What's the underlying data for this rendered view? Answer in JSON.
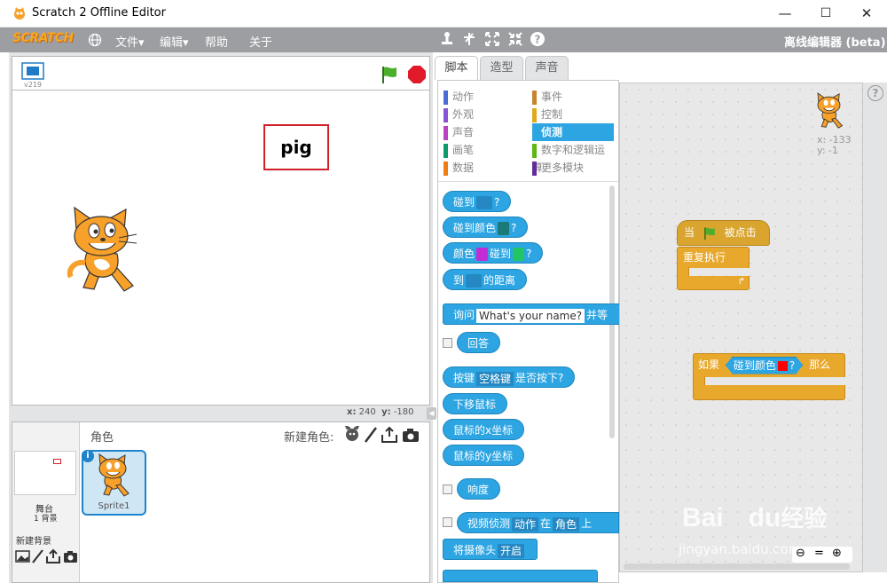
{
  "window": {
    "title": "Scratch 2 Offline Editor",
    "min": "—",
    "max": "☐",
    "close": "✕"
  },
  "menubar": {
    "logo": "SCRATCH",
    "items": [
      "文件▾",
      "编辑▾",
      "帮助",
      "关于"
    ],
    "right_title": "离线编辑器 (beta)"
  },
  "stage": {
    "version": "v219",
    "text_box": "pig",
    "mouse_x_label": "x:",
    "mouse_x": "240",
    "mouse_y_label": "y:",
    "mouse_y": "-180"
  },
  "sprites": {
    "header": "角色",
    "new_sprite_label": "新建角色:",
    "stage_label": "舞台",
    "backdrop_count": "1 背景",
    "new_backdrop_label": "新建背景",
    "sprite_name": "Sprite1"
  },
  "tabs": [
    "脚本",
    "造型",
    "声音"
  ],
  "categories": {
    "left": [
      {
        "name": "动作",
        "color": "#4a6cd4"
      },
      {
        "name": "外观",
        "color": "#8a55d7"
      },
      {
        "name": "声音",
        "color": "#bb42c3"
      },
      {
        "name": "画笔",
        "color": "#0e9a6c"
      },
      {
        "name": "数据",
        "color": "#ee7d16"
      }
    ],
    "right": [
      {
        "name": "事件",
        "color": "#c88330"
      },
      {
        "name": "控制",
        "color": "#e1a91a"
      },
      {
        "name": "侦测",
        "color": "#2ca5e2"
      },
      {
        "name": "数字和逻辑运算",
        "color": "#5cb712"
      },
      {
        "name": "更多模块",
        "color": "#632d99"
      }
    ]
  },
  "blocks": {
    "touching": "碰到",
    "touching_color": "碰到颜色",
    "color_touching_a": "颜色",
    "color_touching_b": "碰到",
    "distance_a": "到",
    "distance_b": "的距离",
    "ask_a": "询问",
    "ask_default": "What's your name?",
    "ask_b": "并等",
    "answer": "回答",
    "key_a": "按键",
    "key_value": "空格键",
    "key_b": "是否按下?",
    "mouse_down": "下移鼠标",
    "mouse_x": "鼠标的x坐标",
    "mouse_y": "鼠标的y坐标",
    "loudness": "响度",
    "video_a": "视频侦测",
    "video_motion": "动作",
    "video_on": "在",
    "video_target": "角色",
    "video_up": "上",
    "camera_a": "将摄像头",
    "camera_value": "开启",
    "q": "?"
  },
  "script": {
    "sprite_x": "x: -133",
    "sprite_y": "y: -1",
    "when_flag_a": "当",
    "when_flag_b": "被点击",
    "forever": "重复执行",
    "if_a": "如果",
    "if_touch": "碰到颜色",
    "if_b": "那么"
  },
  "watermark": {
    "brand": "Bai",
    "brand2": "du",
    "cn": "经验",
    "url": "jingyan.baidu.com"
  },
  "colors": {
    "menubar": "#9c9ea2",
    "sensing": "#2ca5e2",
    "events": "#c88330",
    "control": "#e1a91a"
  }
}
